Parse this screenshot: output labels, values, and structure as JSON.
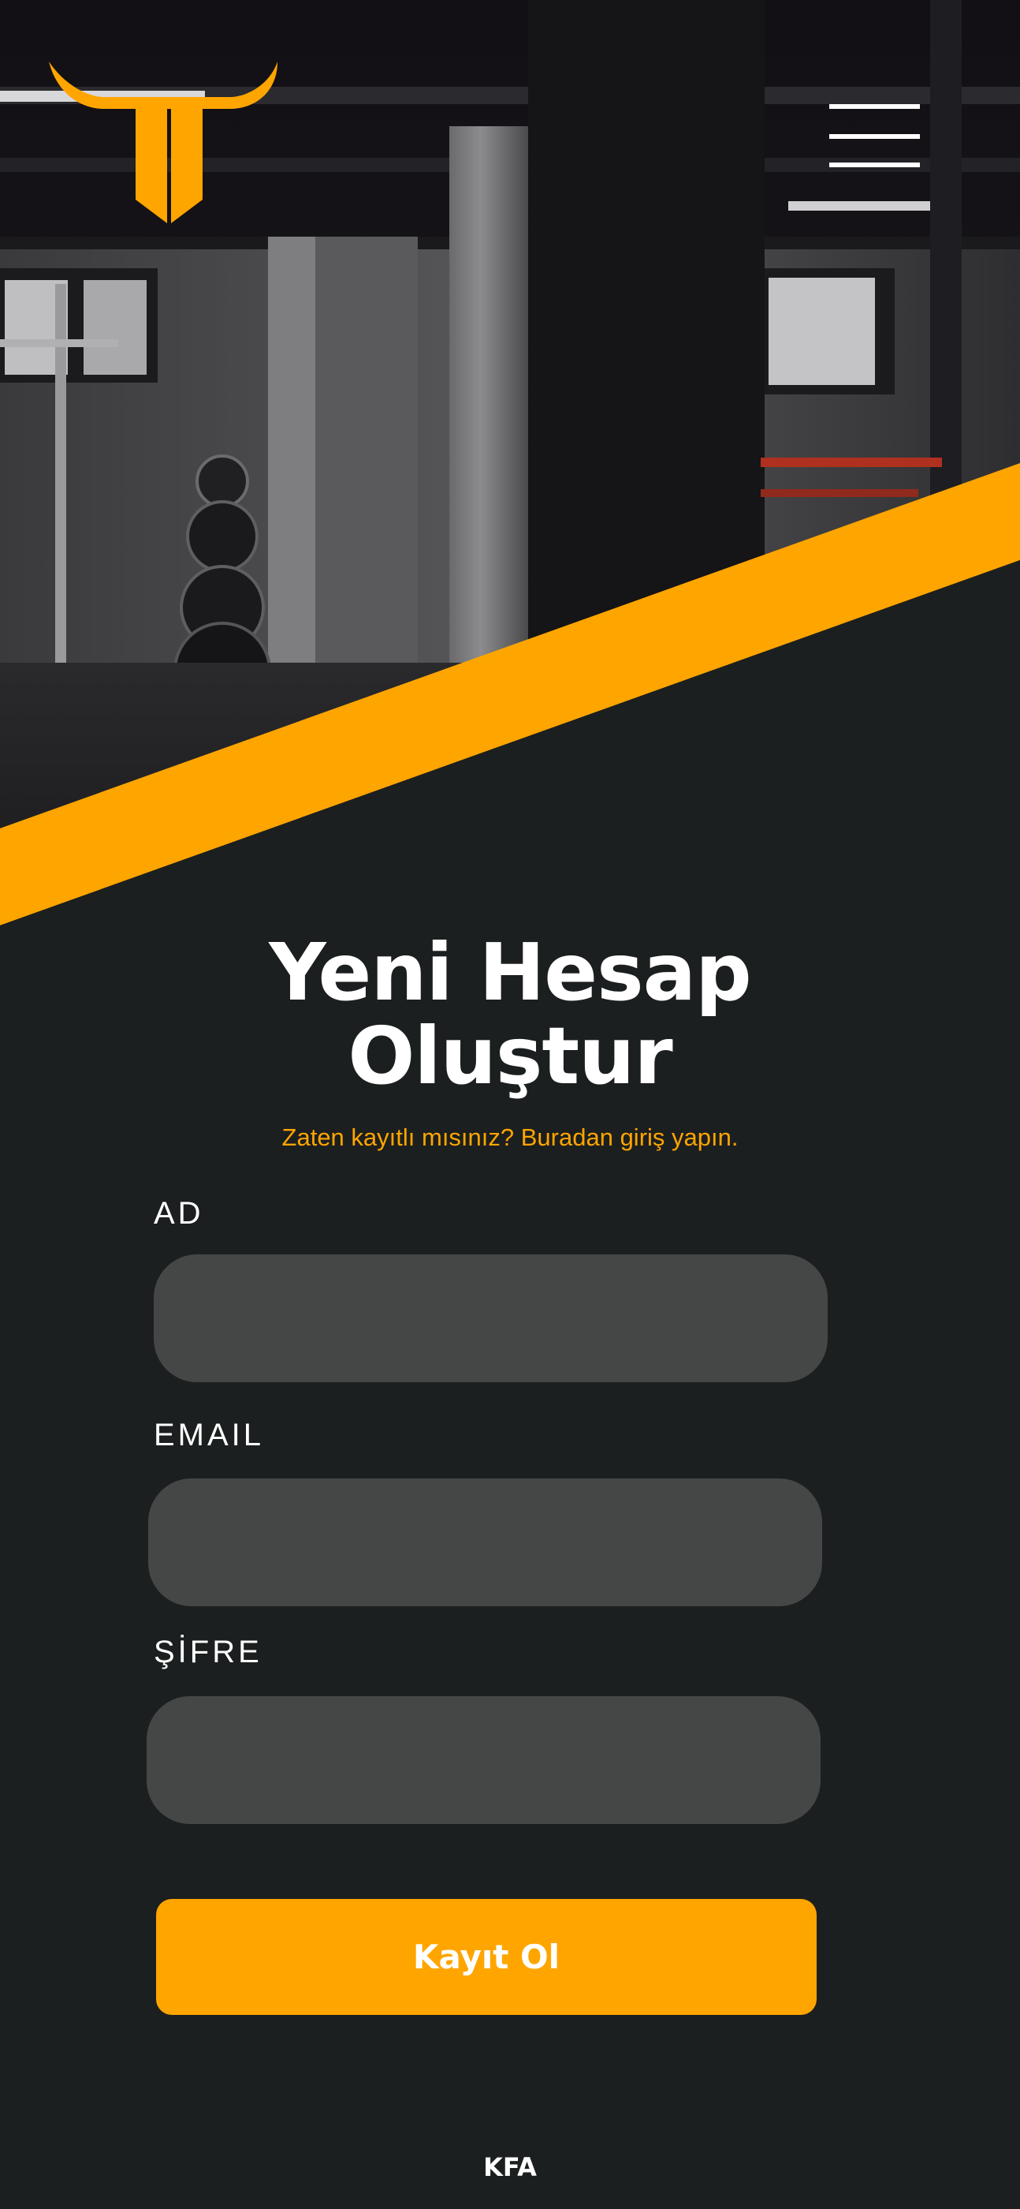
{
  "colors": {
    "accent": "#ffa500",
    "background": "#1c1f1f",
    "field": "#454747",
    "text": "#ffffff"
  },
  "header": {
    "logo_icon": "bull-horns-logo-icon",
    "menu_icon": "hamburger-menu-icon"
  },
  "form": {
    "title_line1": "Yeni Hesap",
    "title_line2": "Oluştur",
    "login_prompt": "Zaten kayıtlı mısınız? Buradan giriş yapın.",
    "name_label": "AD",
    "email_label": "EMAIL",
    "password_label": "ŞİFRE",
    "name_value": "",
    "email_value": "",
    "password_value": "",
    "submit_label": "Kayıt Ol"
  },
  "footer": {
    "text": "KFA"
  }
}
